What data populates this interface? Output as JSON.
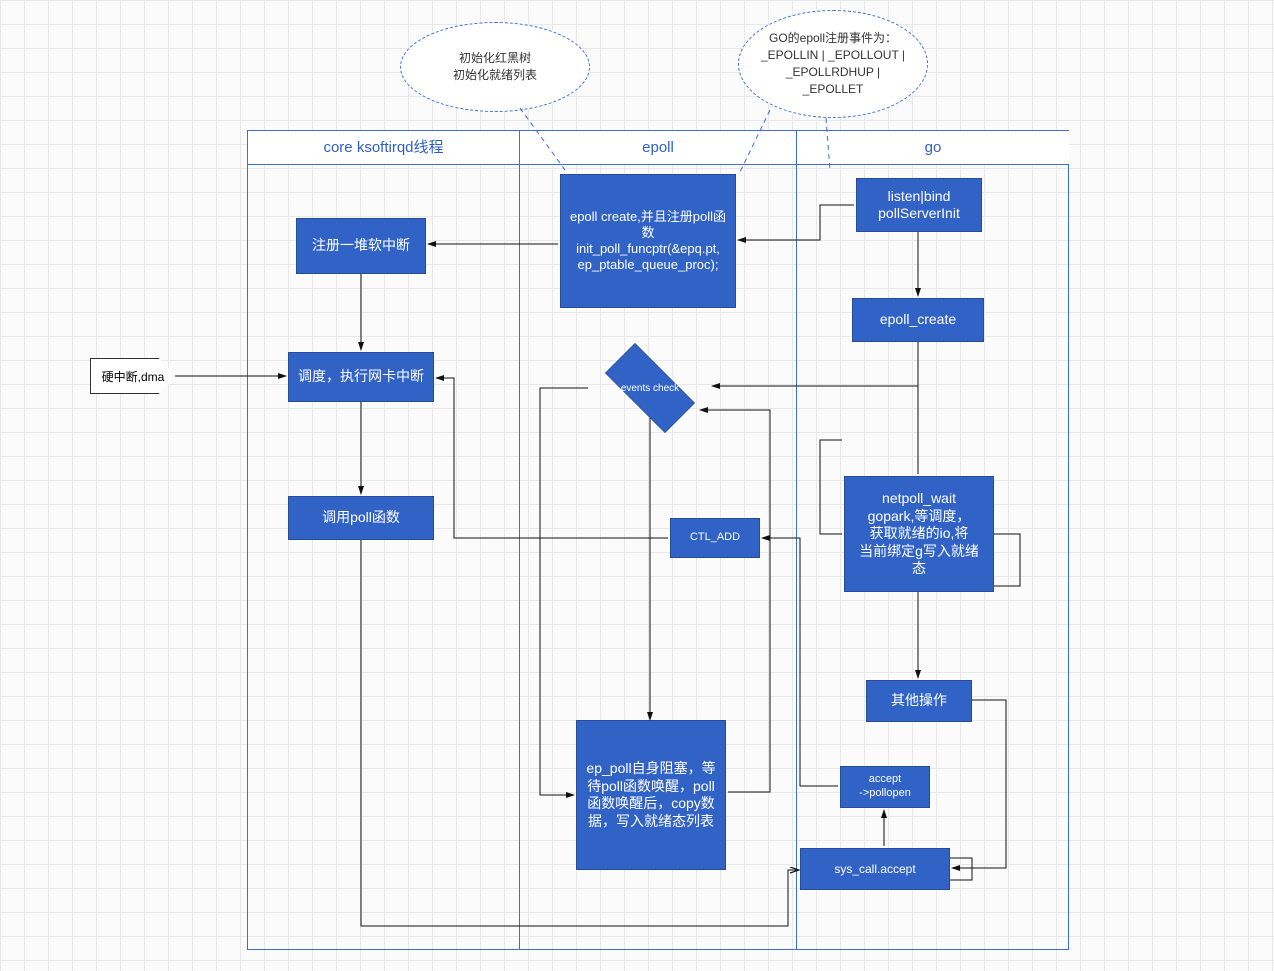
{
  "callouts": {
    "left": "初始化红黑树\n初始化就绪列表",
    "right": "GO的epoll注册事件为：_EPOLLIN | _EPOLLOUT | _EPOLLRDHUP | _EPOLLET"
  },
  "lanes": {
    "core": "core ksoftirqd线程",
    "epoll": "epoll",
    "go": "go"
  },
  "nodes": {
    "hw_irq": "硬中断,dma",
    "reg_softirq": "注册一堆软中断",
    "dispatch_irq": "调度，执行网卡中断",
    "call_poll": "调用poll函数",
    "epoll_create_reg": "epoll create,并且注册poll函数\ninit_poll_funcptr(&epq.pt, ep_ptable_queue_proc);",
    "events_check": "events check",
    "ctl_add": "CTL_ADD",
    "ep_poll_block": "ep_poll自身阻塞，等待poll函数唤醒，poll函数唤醒后，copy数据，写入就绪态列表",
    "listen_bind": "listen|bind\npollServerInit",
    "epoll_create_go": "epoll_create",
    "netpoll_wait": "netpoll_wait\ngopark,等调度，\n获取就绪的io,将\n当前绑定g写入就绪态",
    "other_ops": "其他操作",
    "accept_pollopen": "accept\n->pollopen",
    "sys_call_accept": "sys_call.accept"
  }
}
